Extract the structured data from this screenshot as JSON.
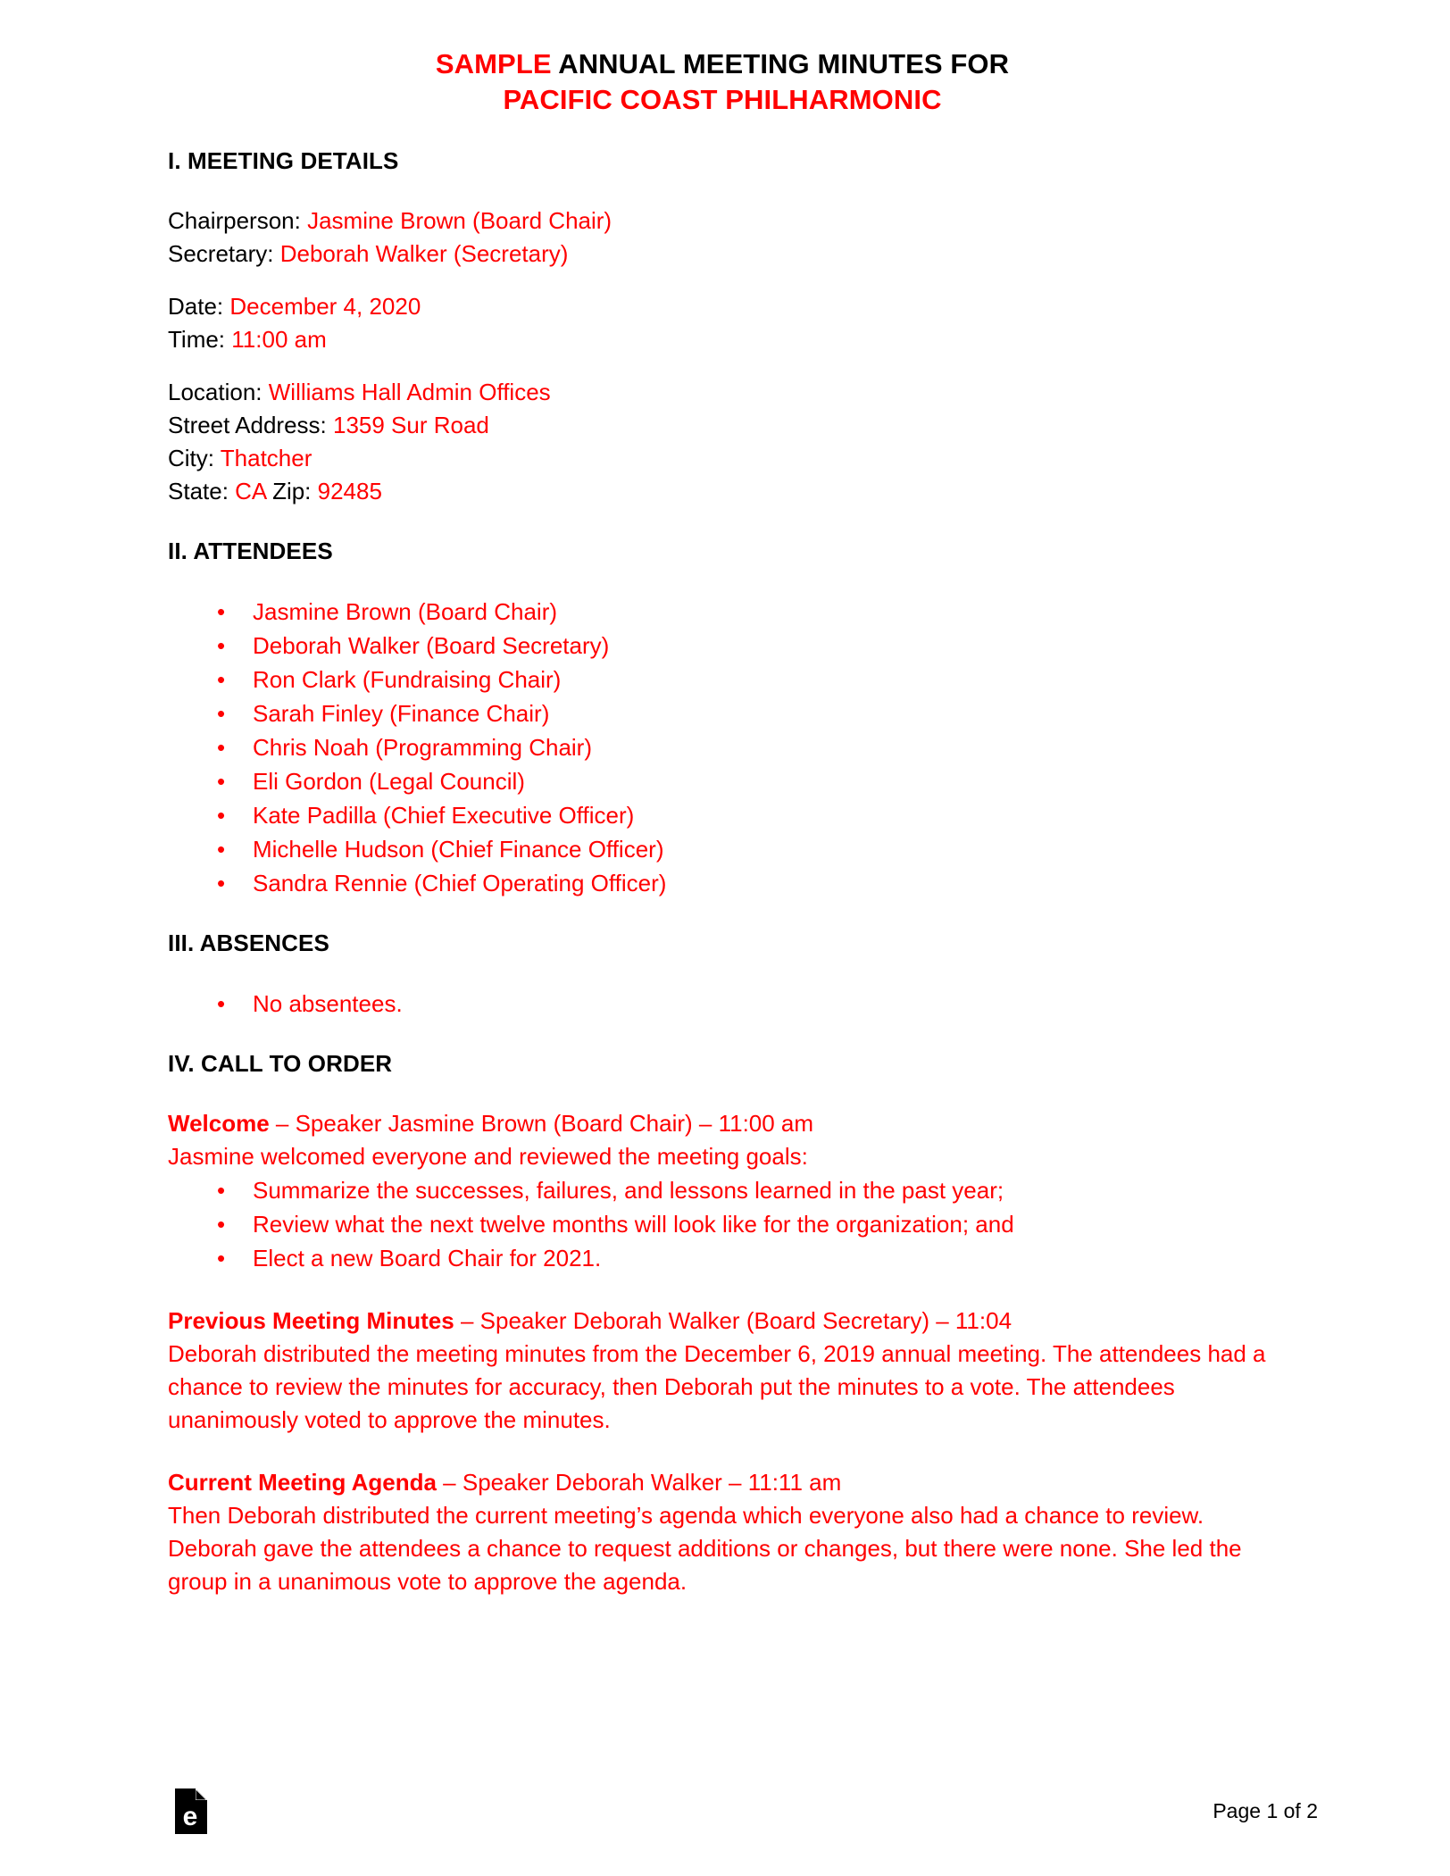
{
  "document": {
    "title_line1_prefix": "SAMPLE",
    "title_line1_rest": " ANNUAL MEETING MINUTES FOR",
    "title_line2": "PACIFIC COAST PHILHARMONIC"
  },
  "sections": {
    "meeting_details": {
      "heading": "I. MEETING DETAILS",
      "fields": [
        {
          "label": "Chairperson: ",
          "value": "Jasmine Brown (Board Chair)"
        },
        {
          "label": "Secretary: ",
          "value": "Deborah Walker (Secretary)"
        },
        {
          "label": "Date: ",
          "value": "December 4, 2020"
        },
        {
          "label": "Time: ",
          "value": "11:00 am"
        },
        {
          "label": "Location: ",
          "value": "Williams Hall Admin Offices"
        },
        {
          "label": "Street Address: ",
          "value": "1359 Sur Road"
        },
        {
          "label": "City: ",
          "value": "Thatcher"
        }
      ],
      "state_label": "State: ",
      "state_value": "CA",
      "zip_label": " Zip: ",
      "zip_value": "92485"
    },
    "attendees": {
      "heading": "II. ATTENDEES",
      "items": [
        "Jasmine Brown (Board Chair)",
        "Deborah Walker (Board Secretary)",
        "Ron Clark (Fundraising Chair)",
        "Sarah Finley (Finance Chair)",
        "Chris Noah (Programming Chair)",
        "Eli Gordon (Legal Council)",
        "Kate Padilla (Chief Executive Officer)",
        "Michelle Hudson (Chief Finance Officer)",
        "Sandra Rennie (Chief Operating Officer)"
      ]
    },
    "absences": {
      "heading": "III. ABSENCES",
      "items": [
        "No absentees."
      ]
    },
    "call_to_order": {
      "heading": "IV. CALL TO ORDER",
      "entries": [
        {
          "title": "Welcome",
          "meta": " – Speaker Jasmine Brown (Board Chair) – 11:00 am",
          "body": "Jasmine welcomed everyone and reviewed the meeting goals:",
          "bullets": [
            "Summarize the successes, failures, and lessons learned in the past year;",
            "Review what the next twelve months will look like for the organization; and",
            "Elect a new Board Chair for 2021."
          ]
        },
        {
          "title": "Previous Meeting Minutes",
          "meta": " – Speaker Deborah Walker (Board Secretary) – 11:04",
          "body": "Deborah distributed the meeting minutes from the December 6, 2019 annual meeting. The attendees had a chance to review the minutes for accuracy, then Deborah put the minutes to a vote. The attendees unanimously voted to approve the minutes.",
          "bullets": []
        },
        {
          "title": "Current Meeting Agenda",
          "meta": " – Speaker Deborah Walker – 11:11 am",
          "body": "Then Deborah distributed the current meeting’s agenda which everyone also had a chance to review. Deborah gave the attendees a chance to request additions or changes, but there were none. She led the group in a unanimous vote to approve the agenda.",
          "bullets": []
        }
      ]
    }
  },
  "footer": {
    "logo_name": "eforms-document-logo",
    "logo_letter": "e",
    "page_number": "Page 1 of 2"
  },
  "colors": {
    "accent_red": "#ff0000",
    "text_black": "#000000"
  }
}
